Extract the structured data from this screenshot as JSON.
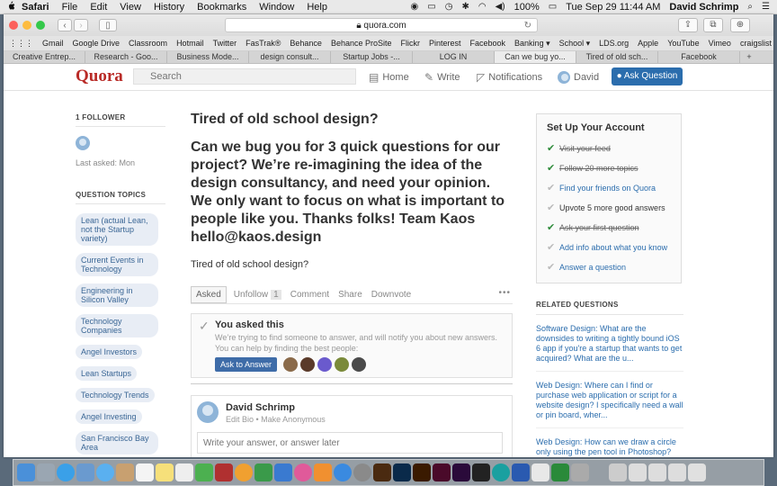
{
  "menubar": {
    "apple": "",
    "app": "Safari",
    "items": [
      "File",
      "Edit",
      "View",
      "History",
      "Bookmarks",
      "Window",
      "Help"
    ],
    "battery": "100%",
    "datetime": "Tue Sep 29  11:44 AM",
    "user": "David Schrimp",
    "search_icon": "search-icon"
  },
  "browser": {
    "url": "quora.com",
    "bookmarks": [
      "Gmail",
      "Google Drive",
      "Classroom",
      "Hotmail",
      "Twitter",
      "FasTrak®",
      "Behance",
      "Behance ProSite",
      "Flickr",
      "Pinterest",
      "Facebook",
      "Banking ▾",
      "School ▾",
      "LDS.org",
      "Apple",
      "YouTube",
      "Vimeo",
      "craigslist"
    ],
    "tabs": [
      "Creative Entrep...",
      "Research - Goo...",
      "Business Mode...",
      "design consult...",
      "Startup Jobs -...",
      "LOG IN",
      "Can we bug yo...",
      "Tired of old sch...",
      "Facebook"
    ],
    "active_tab_index": 6
  },
  "header": {
    "logo": "Quora",
    "search_placeholder": "Search",
    "nav": {
      "home": "Home",
      "write": "Write",
      "notifications": "Notifications",
      "profile": "David"
    },
    "ask_button": "Ask Question"
  },
  "left": {
    "followers": "1 FOLLOWER",
    "last_asked": "Last asked: Mon",
    "topics_heading": "QUESTION TOPICS",
    "topics": [
      "Lean (actual Lean, not the Startup variety)",
      "Current Events in Technology",
      "Engineering in Silicon Valley",
      "Technology Companies",
      "Angel Investors",
      "Lean Startups",
      "Technology Trends",
      "Angel Investing",
      "San Francisco Bay Area"
    ]
  },
  "question": {
    "title": "Tired of old school design?",
    "body": "Can we bug you for 3 quick questions for our project? We’re re-imagining the idea of the design consultancy, and need your opinion. We only want to focus on what is important to people like you. Thanks folks! Team Kaos hello@kaos.design",
    "detail": "Tired of old school design?",
    "actions": {
      "asked": "Asked",
      "unfollow": "Unfollow",
      "unfollow_count": "1",
      "comment": "Comment",
      "share": "Share",
      "downvote": "Downvote",
      "more": "•••"
    },
    "asked_box": {
      "title": "You asked this",
      "text": "We’re trying to find someone to answer, and will notify you about new answers. You can help by finding the best people:",
      "button": "Ask to Answer"
    },
    "answer": {
      "name": "David Schrimp",
      "sub": "Edit Bio • Make Anonymous",
      "placeholder": "Write your answer, or answer later"
    }
  },
  "setup": {
    "title": "Set Up Your Account",
    "items": [
      {
        "text": "Visit your feed",
        "done": true
      },
      {
        "text": "Follow 20 more topics",
        "done": true
      },
      {
        "text": "Find your friends on Quora",
        "done": false
      },
      {
        "text": "Upvote 5 more good answers",
        "done": false
      },
      {
        "text": "Ask your first question",
        "done": true
      },
      {
        "text": "Add info about what you know",
        "done": false
      },
      {
        "text": "Answer a question",
        "done": false
      }
    ]
  },
  "related": {
    "heading": "RELATED QUESTIONS",
    "items": [
      "Software Design: What are the downsides to writing a tightly bound iOS 6 app if you're a startup that wants to get acquired? What are the u...",
      "Web Design: Where can I find or purchase web application or script for a website design? I specifically need a wall or pin board, wher...",
      "Web Design: How can we draw a circle only using the pen tool in Photoshop?"
    ]
  },
  "colors": {
    "quora_red": "#b92b27",
    "link_blue": "#2b6dad",
    "done_green": "#2e8b3a"
  },
  "dock": {
    "apps": [
      "finder",
      "launchpad",
      "safari",
      "mail",
      "messages",
      "calendar",
      "notes",
      "photos",
      "numbers",
      "keynote",
      "itunes",
      "ibooks",
      "app-store",
      "system-preferences",
      "bridge",
      "photoshop",
      "illustrator",
      "indesign",
      "premiere",
      "pinterest",
      "arduino",
      "word",
      "pen",
      "excel",
      "finder2",
      "trash"
    ]
  }
}
